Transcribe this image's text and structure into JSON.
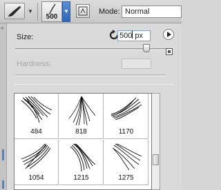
{
  "toolbar": {
    "current_tool_icon": "brush-icon",
    "brush_size_value": "500",
    "brush_preview_icon": "brush-tip-icon",
    "picker_arrow_icon": "chevron-down-icon",
    "panel_toggle_icon": "brush-panel-toggle-icon",
    "mode_label": "Mode:",
    "mode_value": "Normal"
  },
  "brush_picker": {
    "size_label": "Size:",
    "reset_icon": "reset-size-icon",
    "size_value": "500",
    "size_unit": "px",
    "size_slider_fraction": 0.87,
    "hardness_label": "Hardness:",
    "hardness_value": "",
    "menu_icon": "flyout-menu-icon",
    "new_preset_icon": "new-preset-icon",
    "presets": [
      {
        "label": "484"
      },
      {
        "label": "818"
      },
      {
        "label": "1170"
      },
      {
        "label": "1054"
      },
      {
        "label": "1215"
      },
      {
        "label": "1275"
      }
    ]
  }
}
